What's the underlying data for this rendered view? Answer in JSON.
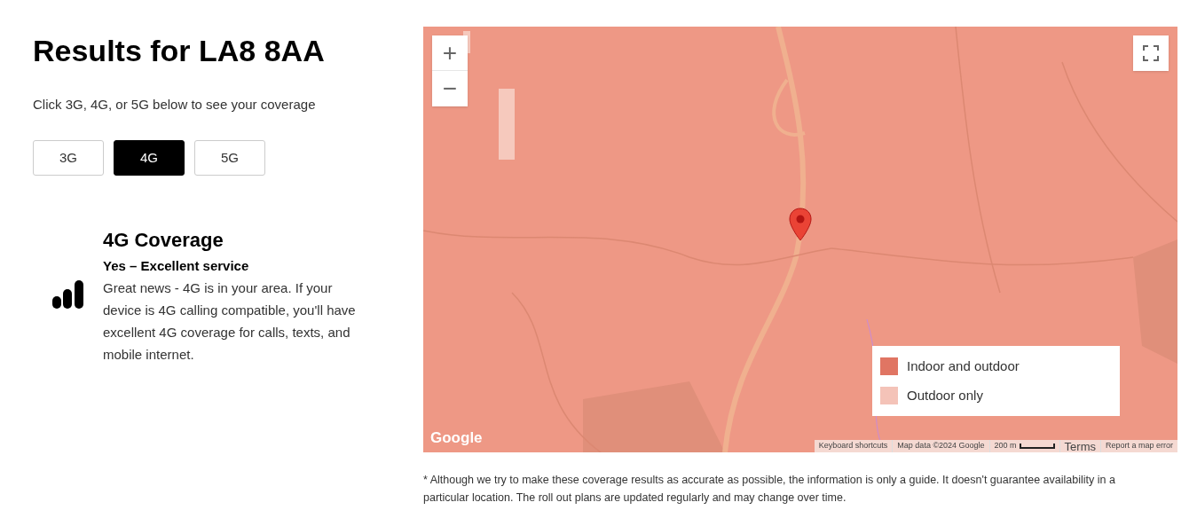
{
  "heading": "Results for LA8 8AA",
  "instruction": "Click 3G, 4G, or 5G below to see your coverage",
  "network_tabs": [
    {
      "label": "3G",
      "selected": false
    },
    {
      "label": "4G",
      "selected": true
    },
    {
      "label": "5G",
      "selected": false
    }
  ],
  "coverage": {
    "title": "4G Coverage",
    "verdict": "Yes – Excellent service",
    "description": "Great news - 4G is in your area. If your device is 4G calling compatible, you'll have excellent 4G coverage for calls, texts, and mobile internet."
  },
  "map": {
    "kind": "picture",
    "zoom_in": "+",
    "zoom_out": "−",
    "legend": [
      {
        "label": "Indoor and outdoor",
        "color": "#e07563"
      },
      {
        "label": "Outdoor only",
        "color": "#f4c3b8"
      }
    ],
    "logo": "Google",
    "attribution": [
      "Keyboard shortcuts",
      "Map data ©2024 Google"
    ],
    "scale": "200 m",
    "terms": "Terms",
    "report": "Report a map error"
  },
  "footnote": "* Although we try to make these coverage results as accurate as possible, the information is only a guide. It doesn't guarantee availability in a particular location. The roll out plans are updated regularly and may change over time."
}
